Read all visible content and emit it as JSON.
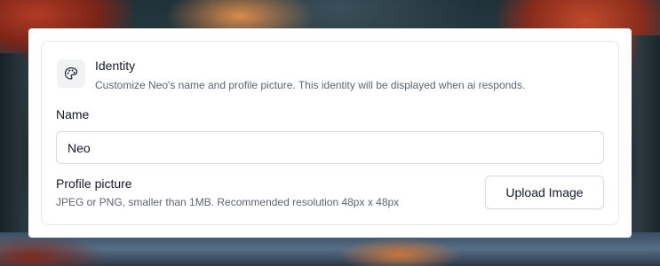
{
  "identity": {
    "icon": "palette-icon",
    "title": "Identity",
    "description": "Customize Neo's name and profile picture. This identity will be displayed when ai responds."
  },
  "name_field": {
    "label": "Name",
    "value": "Neo"
  },
  "profile_picture": {
    "label": "Profile picture",
    "description": "JPEG or PNG, smaller than 1MB. Recommended resolution 48px x 48px",
    "button_label": "Upload Image"
  },
  "colors": {
    "card_background": "#ffffff",
    "text_primary": "#111827",
    "text_secondary": "#5b6472",
    "border": "#d8dbe0",
    "icon_background": "#f1f2f4"
  }
}
